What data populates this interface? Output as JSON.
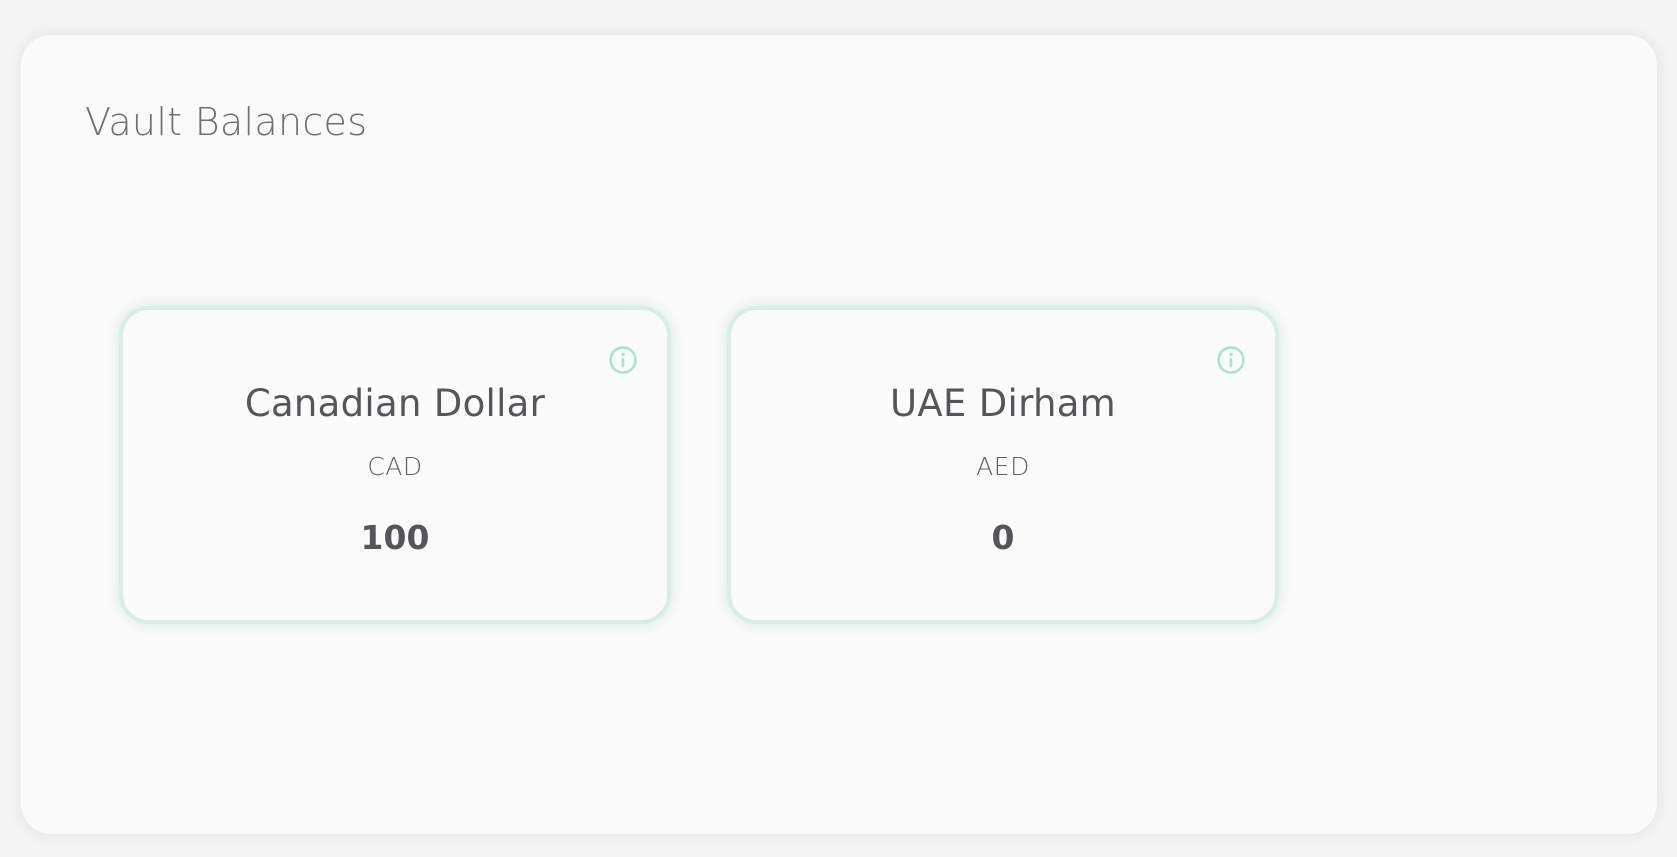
{
  "panel": {
    "title": "Vault Balances"
  },
  "balances": [
    {
      "name": "Canadian Dollar",
      "code": "CAD",
      "amount": "100",
      "icon": "info-icon"
    },
    {
      "name": "UAE Dirham",
      "code": "AED",
      "amount": "0",
      "icon": "info-icon"
    }
  ],
  "colors": {
    "accent_border": "#d7efe3",
    "icon": "#a8e2c9",
    "title_text": "#6e6e74",
    "card_text": "#55555c"
  }
}
